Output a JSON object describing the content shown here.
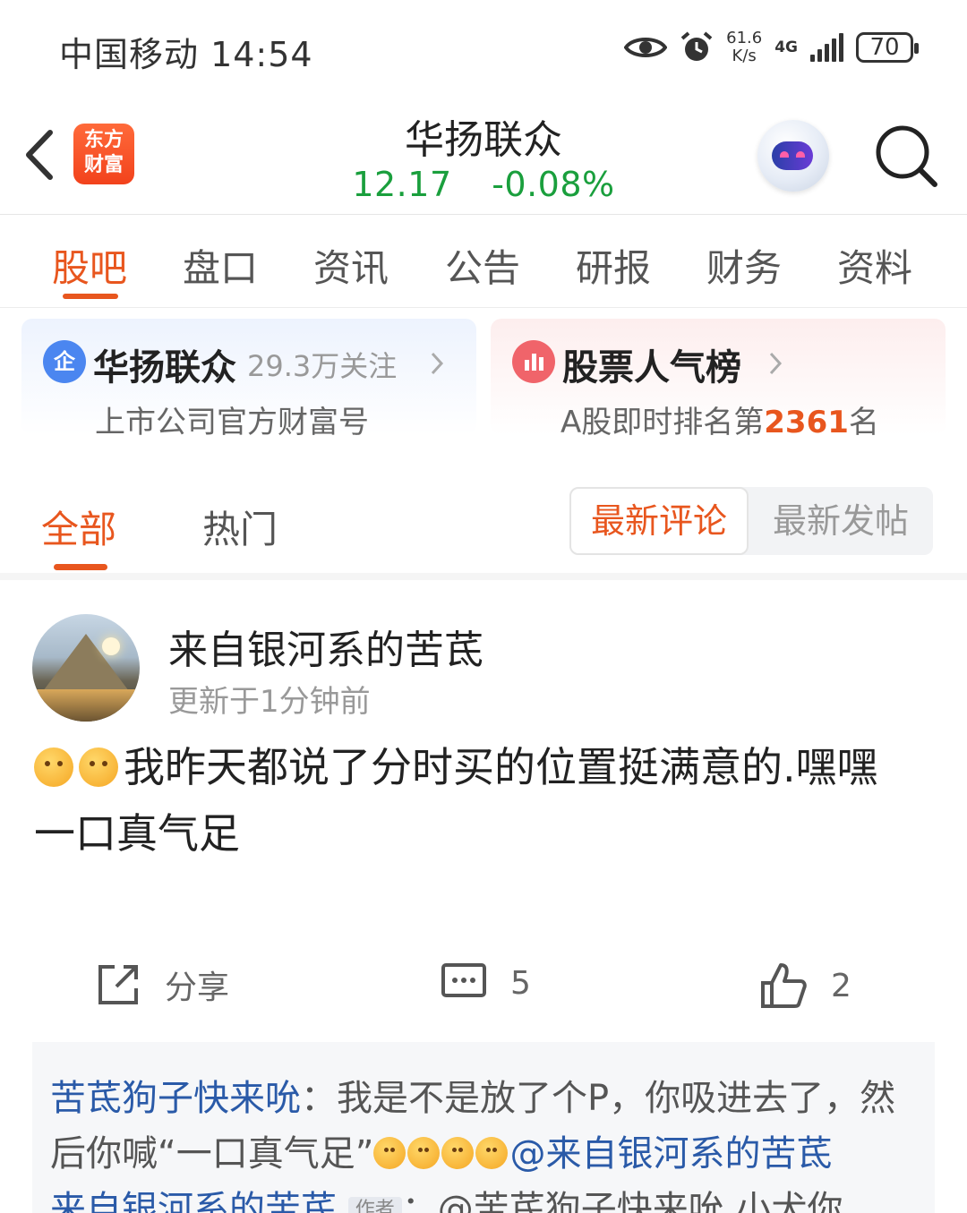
{
  "status_bar": {
    "carrier_time": "中国移动 14:54",
    "net_speed_value": "61.6",
    "net_speed_unit": "K/s",
    "network": "4G",
    "battery": "70"
  },
  "header": {
    "logo_line1": "东方",
    "logo_line2": "财富",
    "stock_name": "华扬联众",
    "price": "12.17",
    "change": "-0.08%"
  },
  "tabs": [
    "股吧",
    "盘口",
    "资讯",
    "公告",
    "研报",
    "财务",
    "资料"
  ],
  "cards": {
    "company": {
      "icon": "企",
      "title": "华扬联众",
      "followers": "29.3万关注",
      "subtitle": "上市公司官方财富号"
    },
    "ranking": {
      "title": "股票人气榜",
      "sub_prefix": "A股即时排名第",
      "rank": "2361",
      "sub_suffix": "名"
    }
  },
  "sub_tabs": {
    "all": "全部",
    "hot": "热门",
    "sort_latest_comment": "最新评论",
    "sort_latest_post": "最新发帖"
  },
  "post": {
    "username": "来自银河系的苦茋",
    "time": "更新于1分钟前",
    "text_line1": "我昨天都说了分时买的位置挺满意的.嘿嘿",
    "text_line2": "一口真气足",
    "share_label": "分享",
    "comment_count": "5",
    "like_count": "2"
  },
  "comment": {
    "user": "苦茋狗子快来吮",
    "text_a": "：我是不是放了个P，你吸进去了，然后你喊“一口真气足”",
    "mention": "@来自银河系的苦茋",
    "line3_user": "来自银河系的苦茋",
    "author_tag": "作者",
    "line3_text": "：@苦茋狗子快来吮 小犬你"
  },
  "colors": {
    "accent": "#e8561e",
    "price_green": "#1a9f3d",
    "link_blue": "#2a5aa8"
  }
}
